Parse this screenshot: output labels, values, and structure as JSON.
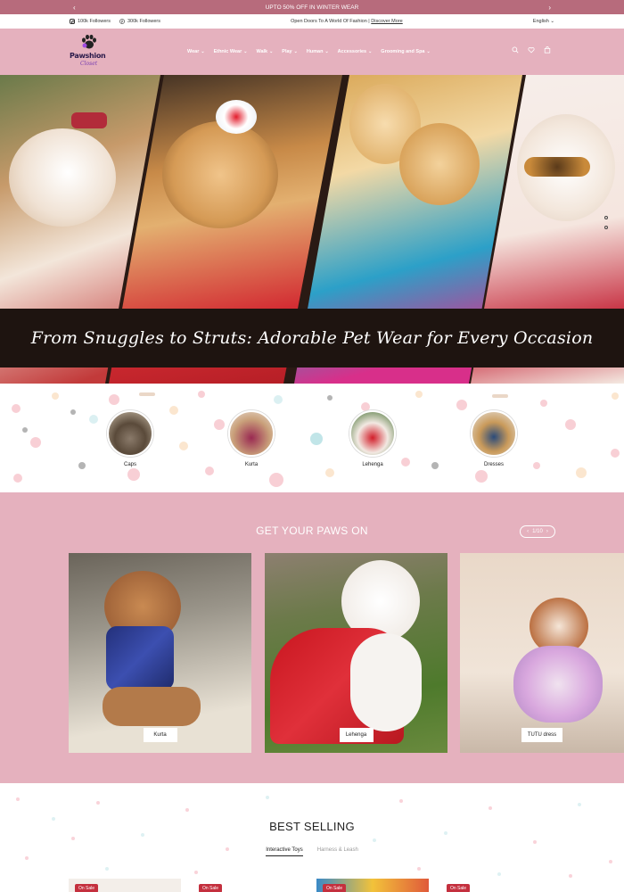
{
  "announcement": {
    "text": "UPTO 50% OFF IN WINTER WEAR",
    "prev_icon": "chevron-left-icon",
    "next_icon": "chevron-right-icon"
  },
  "topbar": {
    "instagram": "100k Followers",
    "facebook": "300k Followers",
    "promo_text": "Open Doors To A World Of Fashion | ",
    "promo_link": "Discover More",
    "language": "English"
  },
  "brand": {
    "name_line1": "Pawshion",
    "name_line2": "Closet"
  },
  "nav": {
    "items": [
      "Wear",
      "Ethnic Wear",
      "Walk",
      "Play",
      "Human",
      "Accessories",
      "Grooming and Spa"
    ]
  },
  "hero": {
    "caption": "From Snuggles to Struts: Adorable Pet Wear for Every Occasion"
  },
  "categories": {
    "items": [
      "Caps",
      "Kurta",
      "Lehenga",
      "Dresses"
    ]
  },
  "paws": {
    "title": "GET YOUR PAWS ON",
    "pager": "1/10",
    "cards": [
      "Kurta",
      "Lehenga",
      "TUTU dress"
    ]
  },
  "best": {
    "title": "BEST SELLING",
    "tabs": [
      "Interactive Toys",
      "Harness & Leash"
    ],
    "badge": "On Sale"
  },
  "colors": {
    "accent": "#e5b1be",
    "announce": "#b76b7c",
    "sale": "#c4303e"
  }
}
